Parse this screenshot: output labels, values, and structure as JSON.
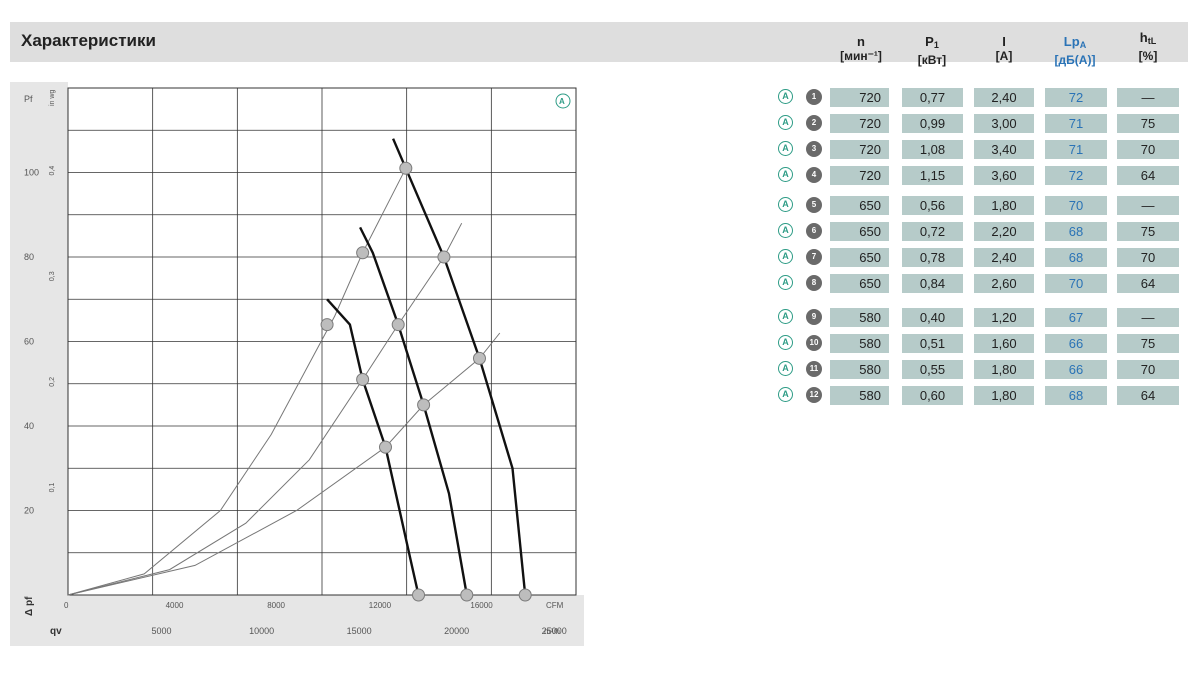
{
  "page": {
    "title": "Характеристики"
  },
  "table": {
    "columns": [
      {
        "name": "n",
        "unit": "[мин⁻¹]"
      },
      {
        "name": "P",
        "sub": "1",
        "unit": "[кВт]"
      },
      {
        "name": "I",
        "unit": "[A]"
      },
      {
        "name": "Lp",
        "sub": "A",
        "unit": "[дБ(A)]",
        "color": "#2a73b6"
      },
      {
        "name": "h",
        "sub": "tL",
        "unit": "[%]"
      }
    ],
    "rows": [
      {
        "marker": "A",
        "num": "1",
        "n": "720",
        "p1": "0,77",
        "i": "2,40",
        "lpa": "72",
        "htl": "—"
      },
      {
        "marker": "A",
        "num": "2",
        "n": "720",
        "p1": "0,99",
        "i": "3,00",
        "lpa": "71",
        "htl": "75"
      },
      {
        "marker": "A",
        "num": "3",
        "n": "720",
        "p1": "1,08",
        "i": "3,40",
        "lpa": "71",
        "htl": "70"
      },
      {
        "marker": "A",
        "num": "4",
        "n": "720",
        "p1": "1,15",
        "i": "3,60",
        "lpa": "72",
        "htl": "64"
      },
      {
        "marker": "A",
        "num": "5",
        "n": "650",
        "p1": "0,56",
        "i": "1,80",
        "lpa": "70",
        "htl": "—"
      },
      {
        "marker": "A",
        "num": "6",
        "n": "650",
        "p1": "0,72",
        "i": "2,20",
        "lpa": "68",
        "htl": "75"
      },
      {
        "marker": "A",
        "num": "7",
        "n": "650",
        "p1": "0,78",
        "i": "2,40",
        "lpa": "68",
        "htl": "70"
      },
      {
        "marker": "A",
        "num": "8",
        "n": "650",
        "p1": "0,84",
        "i": "2,60",
        "lpa": "70",
        "htl": "64"
      },
      {
        "marker": "A",
        "num": "9",
        "n": "580",
        "p1": "0,40",
        "i": "1,20",
        "lpa": "67",
        "htl": "—"
      },
      {
        "marker": "A",
        "num": "10",
        "n": "580",
        "p1": "0,51",
        "i": "1,60",
        "lpa": "66",
        "htl": "75"
      },
      {
        "marker": "A",
        "num": "11",
        "n": "580",
        "p1": "0,55",
        "i": "1,80",
        "lpa": "66",
        "htl": "70"
      },
      {
        "marker": "A",
        "num": "12",
        "n": "580",
        "p1": "0,60",
        "i": "1,80",
        "lpa": "68",
        "htl": "64"
      }
    ]
  },
  "chart_data": {
    "type": "line",
    "corner_marker": "A",
    "y_corner_label": "Pf",
    "y_unit_label": "Pa",
    "y2_unit_label": "in wg",
    "x_unit_label": "CFM",
    "x2_unit_label": "m³/h",
    "y_axis_title": "Δ pf",
    "x_axis_title": "qv",
    "xlim": [
      0,
      16000
    ],
    "ylim": [
      0,
      120
    ],
    "x_ticks": [
      0,
      4000,
      8000,
      12000,
      16000
    ],
    "x_tick_labels": [
      "0",
      "4000",
      "8000",
      "12000",
      "16000"
    ],
    "y_ticks": [
      20,
      40,
      60,
      80,
      100
    ],
    "y_tick_labels": [
      "20",
      "40",
      "60",
      "80",
      "100"
    ],
    "y2_ticks": [
      0.1,
      0.2,
      0.3,
      0.4
    ],
    "y2_tick_labels": [
      "0,1",
      "0,2",
      "0,3",
      "0,4"
    ],
    "x2_ticks": [
      5000,
      10000,
      15000,
      20000,
      25000
    ],
    "x2_tick_labels": [
      "5000",
      "10000",
      "15000",
      "20000",
      "25000"
    ],
    "grid": true,
    "fan_curves": [
      {
        "speed": "580",
        "points": [
          [
            10200,
            70
          ],
          [
            11100,
            64
          ],
          [
            11600,
            51
          ],
          [
            12500,
            35
          ],
          [
            13500,
            8
          ],
          [
            13800,
            0
          ]
        ]
      },
      {
        "speed": "650",
        "points": [
          [
            11500,
            87
          ],
          [
            12000,
            81
          ],
          [
            13000,
            64
          ],
          [
            14000,
            45
          ],
          [
            15000,
            24
          ],
          [
            15700,
            0
          ]
        ]
      },
      {
        "speed": "720",
        "points": [
          [
            12800,
            108
          ],
          [
            13300,
            101
          ],
          [
            14800,
            80
          ],
          [
            16200,
            56
          ],
          [
            17500,
            30
          ],
          [
            18000,
            0
          ]
        ]
      }
    ],
    "system_curves": [
      {
        "points": [
          [
            0,
            0
          ],
          [
            3000,
            5
          ],
          [
            6000,
            20
          ],
          [
            8000,
            38
          ],
          [
            10500,
            66
          ],
          [
            11600,
            81
          ],
          [
            13300,
            101
          ]
        ]
      },
      {
        "points": [
          [
            0,
            0
          ],
          [
            4000,
            6
          ],
          [
            7000,
            17
          ],
          [
            9500,
            32
          ],
          [
            11600,
            51
          ],
          [
            13000,
            64
          ],
          [
            14800,
            80
          ],
          [
            15500,
            88
          ]
        ]
      },
      {
        "points": [
          [
            0,
            0
          ],
          [
            5000,
            7
          ],
          [
            9000,
            20
          ],
          [
            12500,
            35
          ],
          [
            14000,
            45
          ],
          [
            16200,
            56
          ],
          [
            17000,
            62
          ]
        ]
      }
    ],
    "operating_points": [
      {
        "num": "2",
        "x": 13300,
        "y": 101
      },
      {
        "num": "3",
        "x": 14800,
        "y": 80
      },
      {
        "num": "4",
        "x": 16200,
        "y": 56
      },
      {
        "num": "6",
        "x": 11600,
        "y": 81
      },
      {
        "num": "7",
        "x": 13000,
        "y": 64
      },
      {
        "num": "8",
        "x": 14000,
        "y": 45
      },
      {
        "num": "10",
        "x": 10200,
        "y": 64
      },
      {
        "num": "11",
        "x": 11600,
        "y": 51
      },
      {
        "num": "12",
        "x": 12500,
        "y": 35
      },
      {
        "num": "1",
        "x": 18000,
        "y": 0
      },
      {
        "num": "5",
        "x": 15700,
        "y": 0
      },
      {
        "num": "9",
        "x": 13800,
        "y": 0
      }
    ]
  }
}
